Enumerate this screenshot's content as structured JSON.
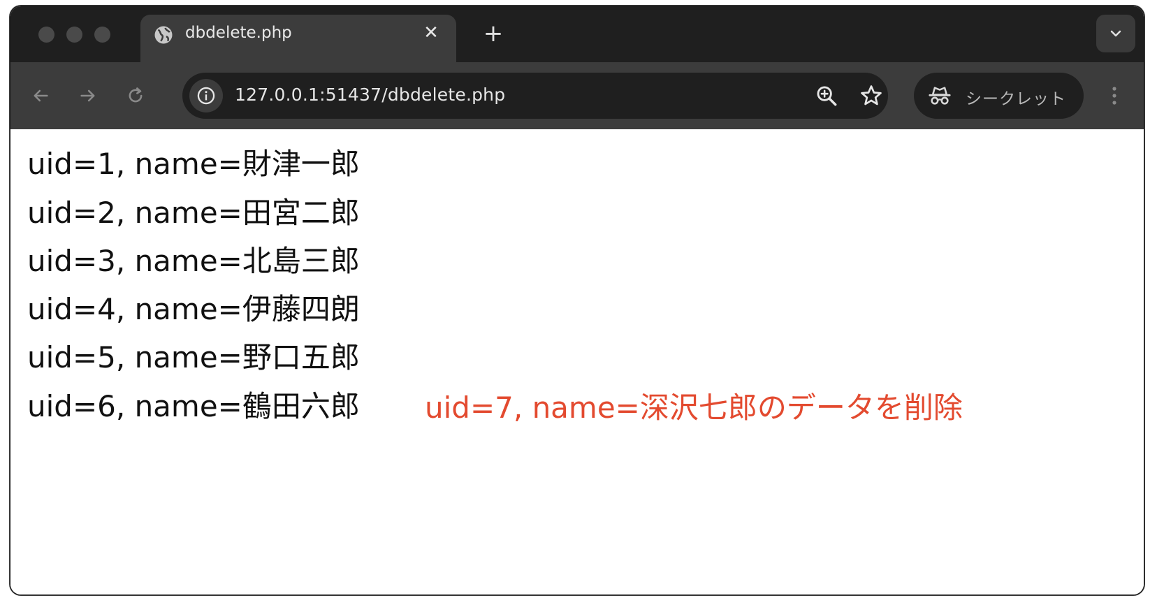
{
  "browser": {
    "tab": {
      "title": "dbdelete.php",
      "icon": "globe-icon"
    },
    "url": "127.0.0.1:51437/dbdelete.php",
    "incognito_label": "シークレット"
  },
  "page": {
    "records": [
      "uid=1, name=財津一郎",
      "uid=2, name=田宮二郎",
      "uid=3, name=北島三郎",
      "uid=4, name=伊藤四朗",
      "uid=5, name=野口五郎",
      "uid=6, name=鶴田六郎"
    ],
    "message": "uid=7, name=深沢七郎のデータを削除",
    "message_color": "#e34a2f"
  }
}
